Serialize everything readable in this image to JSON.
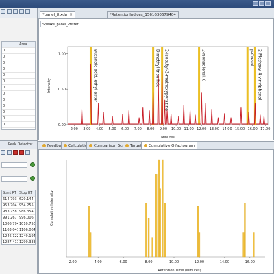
{
  "top_tabs": [
    {
      "label": "*panel_8.xdp",
      "active": true
    },
    {
      "label": "*RetentionIndices_1561630679404",
      "active": false
    }
  ],
  "upper_panel": {
    "header": "Speaks_panel_Pfister",
    "chart_data": {
      "type": "line",
      "ylabel": "Intensity",
      "xlabel": "Minutes",
      "xlim": [
        1.5,
        17.2
      ],
      "ylim": [
        0,
        1.1
      ],
      "x_ticks": [
        "2.00",
        "3.00",
        "4.00",
        "5.00",
        "6.00",
        "7.00",
        "8.00",
        "9.00",
        "10.00",
        "11.00",
        "12.00",
        "13.00",
        "14.00",
        "15.00",
        "16.00",
        "17.00"
      ],
      "y_ticks": [
        "1.00",
        "0.50",
        "0.00"
      ],
      "line_color": "#c8202a",
      "peaks": [
        {
          "x": 2.6,
          "y": 0.22
        },
        {
          "x": 3.3,
          "y": 0.85
        },
        {
          "x": 3.9,
          "y": 0.3
        },
        {
          "x": 4.3,
          "y": 0.18
        },
        {
          "x": 5.0,
          "y": 0.12
        },
        {
          "x": 5.8,
          "y": 0.15
        },
        {
          "x": 6.3,
          "y": 0.2
        },
        {
          "x": 7.1,
          "y": 0.1
        },
        {
          "x": 7.4,
          "y": 0.25
        },
        {
          "x": 7.9,
          "y": 0.2
        },
        {
          "x": 8.2,
          "y": 0.45
        },
        {
          "x": 8.6,
          "y": 0.7
        },
        {
          "x": 8.9,
          "y": 0.75
        },
        {
          "x": 9.1,
          "y": 0.35
        },
        {
          "x": 9.3,
          "y": 0.2
        },
        {
          "x": 9.6,
          "y": 0.15
        },
        {
          "x": 10.2,
          "y": 0.12
        },
        {
          "x": 10.6,
          "y": 0.28
        },
        {
          "x": 11.1,
          "y": 0.2
        },
        {
          "x": 11.5,
          "y": 0.14
        },
        {
          "x": 12.0,
          "y": 0.45
        },
        {
          "x": 12.3,
          "y": 0.3
        },
        {
          "x": 12.8,
          "y": 0.22
        },
        {
          "x": 13.3,
          "y": 0.1
        },
        {
          "x": 13.8,
          "y": 0.16
        },
        {
          "x": 14.3,
          "y": 0.1
        },
        {
          "x": 15.1,
          "y": 0.25
        },
        {
          "x": 15.7,
          "y": 0.18
        },
        {
          "x": 16.2,
          "y": 0.3
        },
        {
          "x": 16.6,
          "y": 0.14
        },
        {
          "x": 16.9,
          "y": 0.12
        }
      ],
      "markers": [
        {
          "x": 3.3,
          "label": "Butanoic acid, ethyl ester",
          "color": "#e8b400"
        },
        {
          "x": 8.2,
          "label": "Dimethyl trisulfide",
          "color": "#e8b400"
        },
        {
          "x": 8.9,
          "label": "2-isobutyl-3-methoxypyrazine",
          "color": "#e8b400"
        },
        {
          "x": 11.8,
          "label": "2-Nonadienal, (",
          "color": "#e8b400"
        },
        {
          "x": 15.6,
          "label": "p-Cresol",
          "color": "#e8b400"
        },
        {
          "x": 16.2,
          "label": "2-Methoxy-4-vinylphenol",
          "color": "#e8b400"
        }
      ]
    }
  },
  "bottom_tabs": [
    {
      "label": "Feedback"
    },
    {
      "label": "Calculation"
    },
    {
      "label": "Comparison Scan"
    },
    {
      "label": "Targets"
    },
    {
      "label": "Cumulative Olfactogram",
      "active": true
    }
  ],
  "lower_panel": {
    "chart_data": {
      "type": "bar",
      "ylabel": "Cumulative Intensity",
      "xlabel": "Retention Time (Minutes)",
      "xlim": [
        1.5,
        17.2
      ],
      "ylim": [
        0,
        1.0
      ],
      "x_ticks": [
        "2.00",
        "4.00",
        "6.00",
        "8.00",
        "10.00",
        "12.00",
        "14.00",
        "16.00"
      ],
      "bar_color": "#f0c040",
      "bars": [
        {
          "x": 3.3,
          "y": 0.52
        },
        {
          "x": 3.4,
          "y": 0.25
        },
        {
          "x": 7.8,
          "y": 0.55
        },
        {
          "x": 8.0,
          "y": 0.4
        },
        {
          "x": 8.3,
          "y": 0.2
        },
        {
          "x": 8.6,
          "y": 0.85
        },
        {
          "x": 8.8,
          "y": 1.0
        },
        {
          "x": 8.9,
          "y": 0.7
        },
        {
          "x": 9.1,
          "y": 1.0
        },
        {
          "x": 9.3,
          "y": 0.55
        },
        {
          "x": 11.9,
          "y": 0.52
        },
        {
          "x": 12.0,
          "y": 0.25
        },
        {
          "x": 15.5,
          "y": 0.25
        },
        {
          "x": 15.6,
          "y": 0.55
        },
        {
          "x": 16.3,
          "y": 0.25
        }
      ]
    }
  },
  "left_top_table": {
    "header": [
      "",
      "Area"
    ],
    "rows": [
      [
        "0",
        ""
      ],
      [
        "0",
        ""
      ],
      [
        "0",
        ""
      ],
      [
        "0",
        ""
      ],
      [
        "0",
        ""
      ],
      [
        "0",
        ""
      ],
      [
        "0",
        ""
      ],
      [
        "0",
        ""
      ],
      [
        "0",
        ""
      ],
      [
        "0",
        ""
      ],
      [
        "0",
        ""
      ],
      [
        "0",
        ""
      ],
      [
        "0",
        ""
      ]
    ]
  },
  "left_bottom": {
    "view_tab": "Peak Detector",
    "table_header": [
      "Start RT",
      "Stop RT"
    ],
    "rows": [
      [
        "614.793",
        "620.144"
      ],
      [
        "953.704",
        "954.255"
      ],
      [
        "983.758",
        "986.354"
      ],
      [
        "991.267",
        "996.006"
      ],
      [
        "1006.794",
        "1010.750"
      ],
      [
        "1103.041",
        "1106.004"
      ],
      [
        "1246.122",
        "1249.194"
      ],
      [
        "1287.411",
        "1290.333"
      ]
    ]
  }
}
